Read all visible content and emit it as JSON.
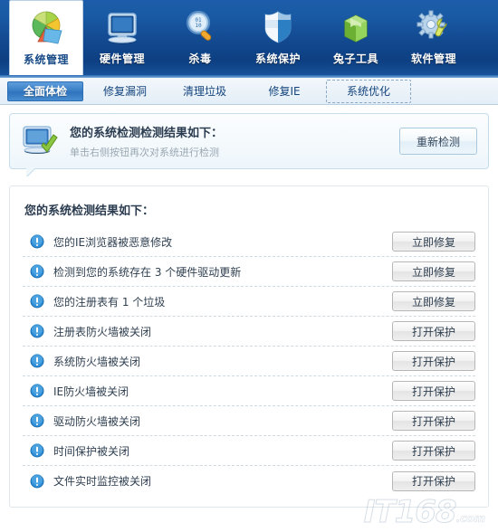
{
  "toolbar": {
    "items": [
      {
        "label": "系统管理",
        "icon": "pie-chart-icon",
        "active": true
      },
      {
        "label": "硬件管理",
        "icon": "monitor-icon",
        "active": false
      },
      {
        "label": "杀毒",
        "icon": "magnifier-icon",
        "active": false
      },
      {
        "label": "系统保护",
        "icon": "shield-icon",
        "active": false
      },
      {
        "label": "兔子工具",
        "icon": "green-box-icon",
        "active": false
      },
      {
        "label": "软件管理",
        "icon": "gear-wrench-icon",
        "active": false
      }
    ]
  },
  "tabs": [
    {
      "label": "全面体检",
      "state": "active"
    },
    {
      "label": "修复漏洞",
      "state": "normal"
    },
    {
      "label": "清理垃圾",
      "state": "normal"
    },
    {
      "label": "修复IE",
      "state": "normal"
    },
    {
      "label": "系统优化",
      "state": "focused"
    }
  ],
  "info_panel": {
    "icon": "monitor-check-icon",
    "title": "您的系统检测检测结果如下：",
    "subtitle": "单击右侧按钮再次对系统进行检测",
    "rescan_button": "重新检测"
  },
  "results": {
    "heading": "您的系统检测结果如下：",
    "rows": [
      {
        "icon": "info-exclamation-icon",
        "label": "您的IE浏览器被恶意修改",
        "action": "立即修复"
      },
      {
        "icon": "info-exclamation-icon",
        "label": "检测到您的系统存在 3 个硬件驱动更新",
        "action": "立即修复"
      },
      {
        "icon": "info-exclamation-icon",
        "label": "您的注册表有 1 个垃圾",
        "action": "立即修复"
      },
      {
        "icon": "info-exclamation-icon",
        "label": "注册表防火墙被关闭",
        "action": "打开保护"
      },
      {
        "icon": "info-exclamation-icon",
        "label": "系统防火墙被关闭",
        "action": "打开保护"
      },
      {
        "icon": "info-exclamation-icon",
        "label": "IE防火墙被关闭",
        "action": "打开保护"
      },
      {
        "icon": "info-exclamation-icon",
        "label": "驱动防火墙被关闭",
        "action": "打开保护"
      },
      {
        "icon": "info-exclamation-icon",
        "label": "时间保护被关闭",
        "action": "打开保护"
      },
      {
        "icon": "info-exclamation-icon",
        "label": "文件实时监控被关闭",
        "action": "打开保护"
      }
    ]
  },
  "watermark": {
    "text": "IT168",
    "suffix": ".com"
  },
  "colors": {
    "toolbar_blue": "#12488e",
    "tab_active_blue": "#3a7fc6",
    "info_blue": "#2f8fd8",
    "panel_border": "#c5dced",
    "text_dark": "#2b3c50",
    "text_muted": "#9aa7b2"
  }
}
